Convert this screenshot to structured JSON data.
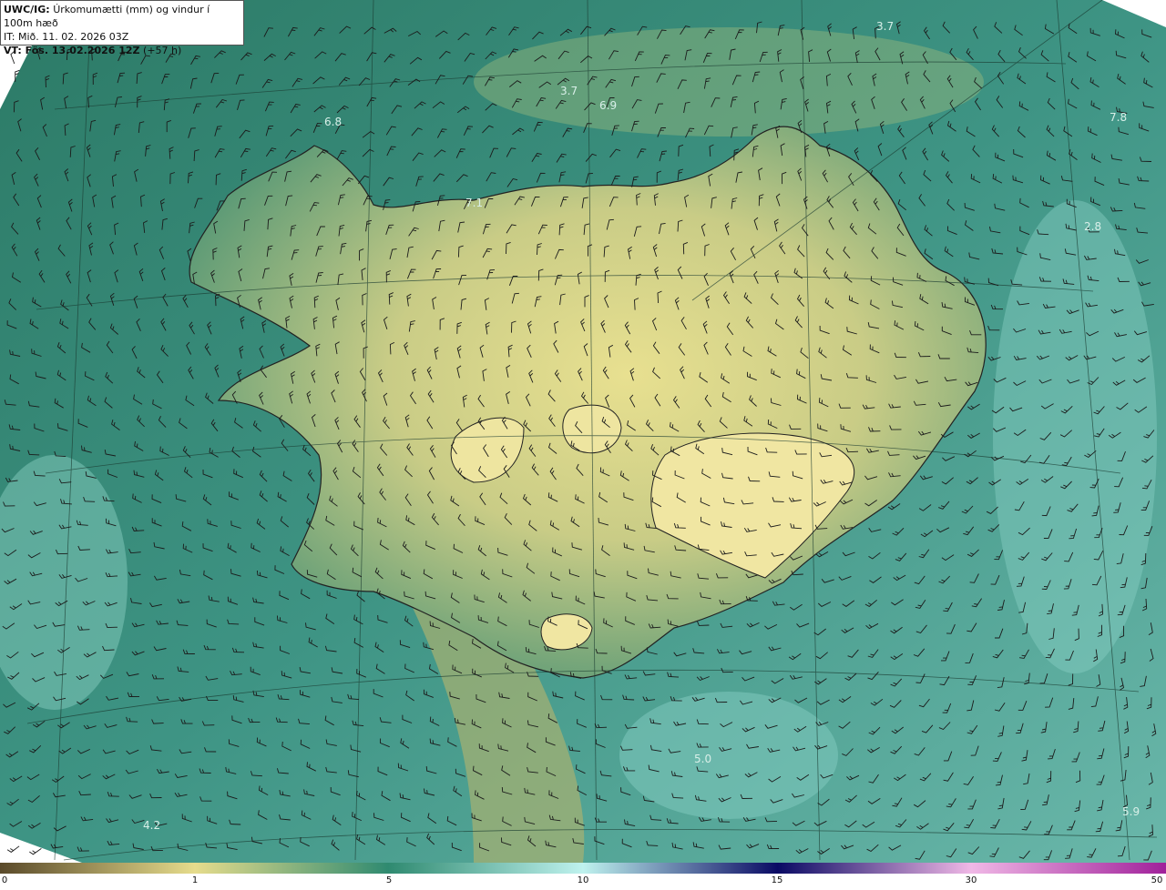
{
  "header": {
    "product": "UWC/IG:",
    "title": "Úrkomumætti (mm) og vindur í 100m hæð",
    "it_label": "IT:",
    "it_value": "Mið. 11. 02. 2026 03Z",
    "vt_label": "VT: Fös. 13.02.2026 12Z",
    "vt_lead": "(+57 h)"
  },
  "map_values": [
    "3.7",
    "3.7",
    "6.9",
    "6.8",
    "7.8",
    "7.1",
    "2.8",
    "5.0",
    "4.2",
    "5.9"
  ],
  "colorbar": {
    "tick_labels": [
      "0",
      "1",
      "5",
      "10",
      "15",
      "30",
      "50"
    ],
    "colors": [
      "#5a4a2a",
      "#a08e52",
      "#e6dc8c",
      "#2f8a70",
      "#bff2ee",
      "#0a0a64",
      "#f0b8e6",
      "#a0209a"
    ]
  }
}
